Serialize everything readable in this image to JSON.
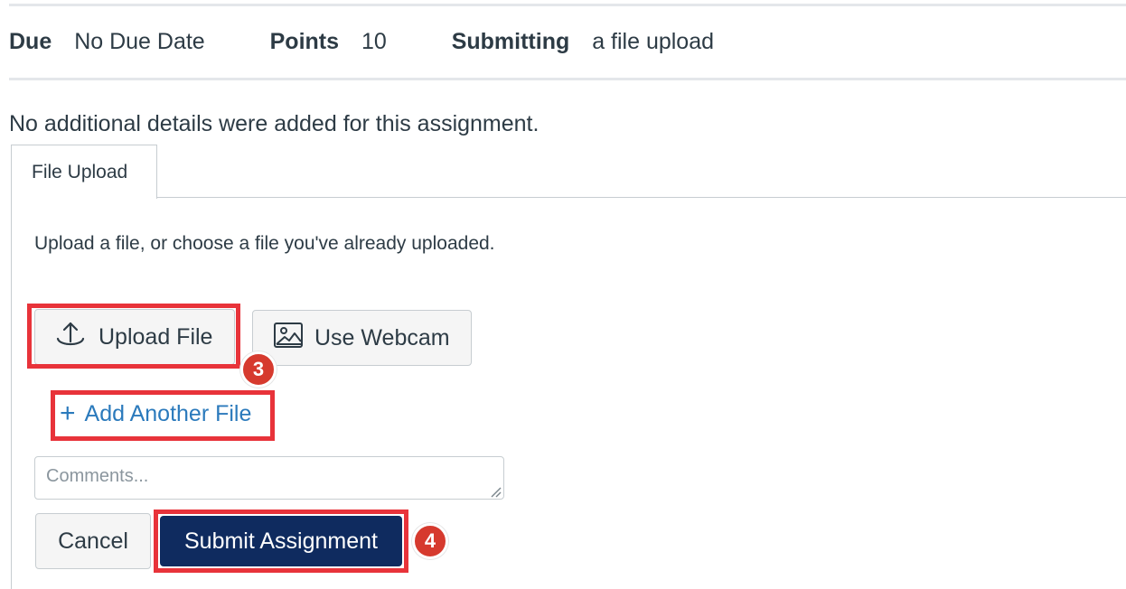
{
  "assignment_meta": {
    "due_label": "Due",
    "due_value": "No Due Date",
    "points_label": "Points",
    "points_value": "10",
    "submitting_label": "Submitting",
    "submitting_value": "a file upload"
  },
  "details_text": "No additional details were added for this assignment.",
  "tabs": [
    {
      "label": "File Upload",
      "active": true
    }
  ],
  "upload_panel": {
    "instructions": "Upload a file, or choose a file you've already uploaded.",
    "upload_button_label": "Upload File",
    "webcam_button_label": "Use Webcam",
    "add_file_label": "Add Another File",
    "comments_placeholder": "Comments...",
    "cancel_label": "Cancel",
    "submit_label": "Submit Assignment"
  },
  "step_markers": [
    "3",
    "4"
  ],
  "icons": {
    "upload": "upload-arrow-icon",
    "webcam": "image-icon",
    "add": "plus-icon"
  },
  "colors": {
    "highlight": "#e8333a",
    "step_badge": "#d63a2e",
    "link": "#2b7abc",
    "primary_button": "#0f2b5f"
  }
}
